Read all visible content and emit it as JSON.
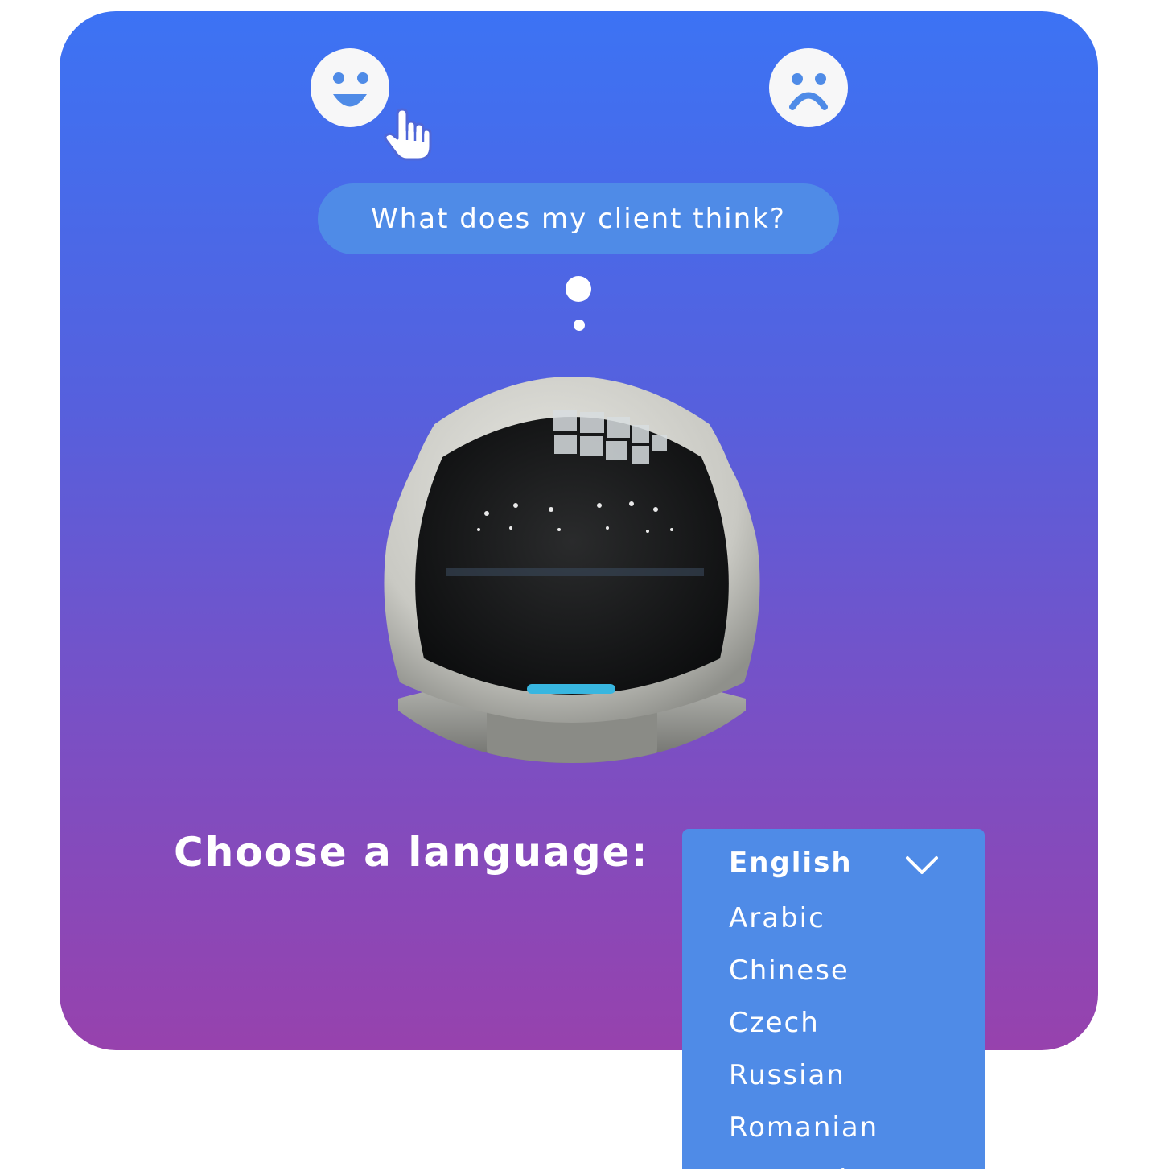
{
  "feedback": {
    "positive_icon": "happy-face-icon",
    "negative_icon": "sad-face-icon",
    "pointer_icon": "hand-pointer-icon"
  },
  "bubble": {
    "text": "What does my client think?"
  },
  "language": {
    "label": "Choose a language:",
    "selected": "English",
    "options": [
      "Arabic",
      "Chinese",
      "Czech",
      "Russian",
      "Romanian",
      "Hungarian"
    ]
  },
  "colors": {
    "gradient_top": "#3c73f4",
    "gradient_bottom": "#9742ad",
    "accent_blue": "#4f8be7",
    "text": "#ffffff"
  }
}
